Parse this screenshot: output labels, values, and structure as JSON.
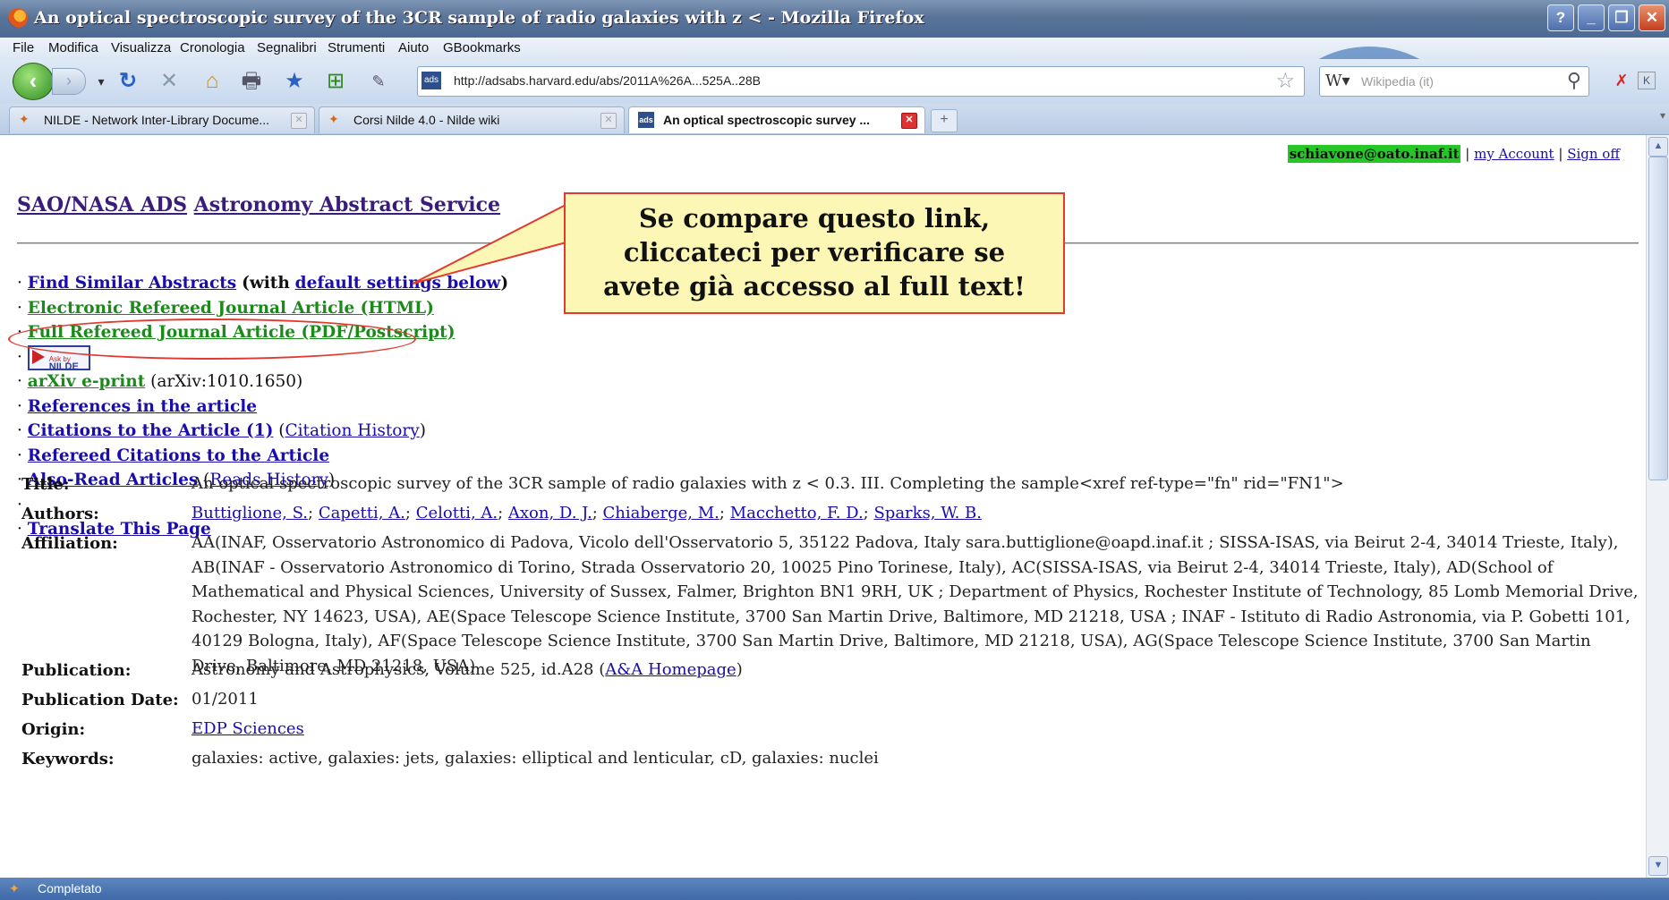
{
  "window": {
    "title": "An optical spectroscopic survey of the 3CR sample of radio galaxies with z < - Mozilla Firefox"
  },
  "menu": [
    "File",
    "Modifica",
    "Visualizza",
    "Cronologia",
    "Segnalibri",
    "Strumenti",
    "Aiuto",
    "GBookmarks"
  ],
  "nav": {
    "url": "http://adsabs.harvard.edu/abs/2011A%26A...525A..28B",
    "search_placeholder": "Wikipedia (it)"
  },
  "tabs": [
    {
      "label": "NILDE - Network Inter-Library Docume...",
      "active": false
    },
    {
      "label": "Corsi Nilde 4.0 - Nilde wiki",
      "active": false
    },
    {
      "label": "An optical spectroscopic survey ...",
      "active": true
    }
  ],
  "account": {
    "email": "schiavone@oato.inaf.it",
    "my_account": "my Account",
    "sign_off": "Sign off",
    "sep": "|"
  },
  "ads": {
    "part1": "SAO/NASA ADS",
    "part2": "Astronomy Abstract Service"
  },
  "links": {
    "find_similar": "Find Similar Abstracts",
    "with_open": "(with",
    "default_settings": "default settings below",
    "close_paren": ")",
    "electronic": "Electronic Refereed Journal Article (HTML)",
    "full_refereed": "Full Refereed Journal Article (PDF/Postscript)",
    "nilde_ask": "Ask by",
    "nilde_name": "NILDE",
    "arxiv": "arXiv e-print",
    "arxiv_id": "(arXiv:1010.1650)",
    "references": "References in the article",
    "citations": "Citations to the Article (1)",
    "citation_history": "Citation History",
    "refereed_citations": "Refereed Citations to the Article",
    "also_read": "Also-Read Articles",
    "reads_history": "Reads History",
    "translate": "Translate This Page",
    "bullet": "·"
  },
  "callout": {
    "line1": "Se compare questo link,",
    "line2": "cliccateci per verificare se",
    "line3": "avete già accesso al full text!"
  },
  "meta": {
    "title_k": "Title:",
    "title_v": "An optical spectroscopic survey of the 3CR sample of radio galaxies with z < 0.3. III. Completing the sample<xref ref-type=\"fn\" rid=\"FN1\">",
    "authors_k": "Authors:",
    "authors": [
      "Buttiglione, S.",
      "Capetti, A.",
      "Celotti, A.",
      "Axon, D. J.",
      "Chiaberge, M.",
      "Macchetto, F. D.",
      "Sparks, W. B."
    ],
    "affiliation_k": "Affiliation:",
    "affiliation_v": "AA(INAF, Osservatorio Astronomico di Padova, Vicolo dell'Osservatorio 5, 35122 Padova, Italy sara.buttiglione@oapd.inaf.it ; SISSA-ISAS, via Beirut 2-4, 34014 Trieste, Italy), AB(INAF - Osservatorio Astronomico di Torino, Strada Osservatorio 20, 10025 Pino Torinese, Italy), AC(SISSA-ISAS, via Beirut 2-4, 34014 Trieste, Italy), AD(School of Mathematical and Physical Sciences, University of Sussex, Falmer, Brighton BN1 9RH, UK ; Department of Physics, Rochester Institute of Technology, 85 Lomb Memorial Drive, Rochester, NY 14623, USA), AE(Space Telescope Science Institute, 3700 San Martin Drive, Baltimore, MD 21218, USA ; INAF - Istituto di Radio Astronomia, via P. Gobetti 101, 40129 Bologna, Italy), AF(Space Telescope Science Institute, 3700 San Martin Drive, Baltimore, MD 21218, USA), AG(Space Telescope Science Institute, 3700 San Martin Drive, Baltimore, MD 21218, USA)",
    "publication_k": "Publication:",
    "publication_v": "Astronomy and Astrophysics, Volume 525, id.A28",
    "publication_link": "A&A Homepage",
    "pubdate_k": "Publication Date:",
    "pubdate_v": "01/2011",
    "origin_k": "Origin:",
    "origin_v": "EDP Sciences",
    "keywords_k": "Keywords:",
    "keywords_v": "galaxies: active, galaxies: jets, galaxies: elliptical and lenticular, cD, galaxies: nuclei"
  },
  "status": {
    "text": "Completato"
  },
  "colors": {
    "email_highlight": "#27c627",
    "callout_bg": "#fdf7b6",
    "callout_border": "#e23a2f",
    "link_green": "#1b8a1b"
  }
}
